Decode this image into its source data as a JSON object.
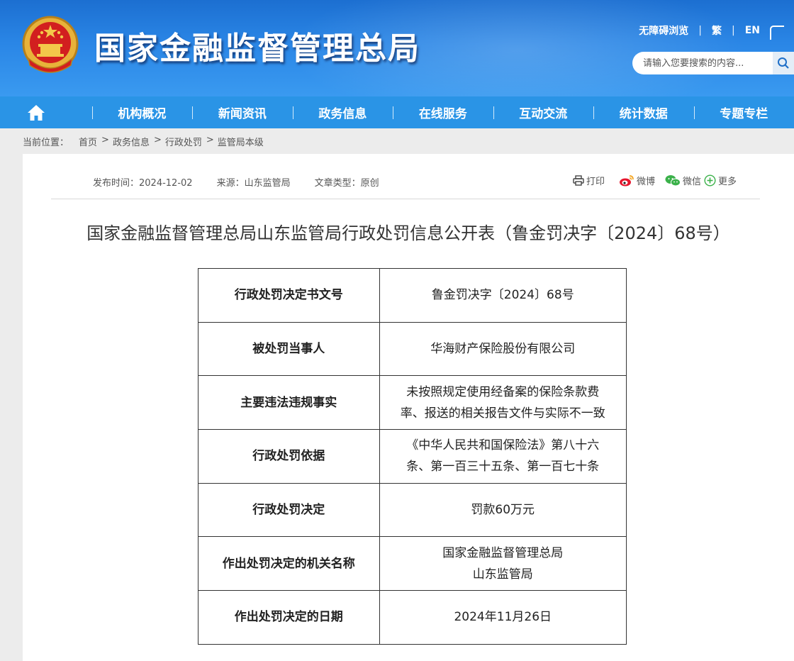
{
  "header": {
    "site_title": "国家金融监督管理总局",
    "top_links": [
      "无障碍浏览",
      "繁",
      "EN"
    ],
    "search_placeholder": "请输入您要搜索的内容..."
  },
  "nav": {
    "items": [
      "机构概况",
      "新闻资讯",
      "政务信息",
      "在线服务",
      "互动交流",
      "统计数据",
      "专题专栏"
    ]
  },
  "breadcrumb": {
    "label": "当前位置：",
    "items": [
      "首页",
      "政务信息",
      "行政处罚",
      "监管局本级"
    ]
  },
  "article": {
    "publish_time": "发布时间：2024-12-02",
    "source": "来源：山东监管局",
    "type": "文章类型：原创",
    "share": {
      "print": "打印",
      "weibo": "微博",
      "wechat": "微信",
      "more": "更多"
    },
    "title": "国家金融监督管理总局山东监管局行政处罚信息公开表（鲁金罚决字〔2024〕68号）"
  },
  "table": {
    "rows": [
      {
        "key": "行政处罚决定书文号",
        "value": [
          "鲁金罚决字〔2024〕68号"
        ]
      },
      {
        "key": "被处罚当事人",
        "value": [
          "华海财产保险股份有限公司"
        ]
      },
      {
        "key": "主要违法违规事实",
        "value": [
          "未按照规定使用经备案的保险条款费",
          "率、报送的相关报告文件与实际不一致"
        ]
      },
      {
        "key": "行政处罚依据",
        "value": [
          "《中华人民共和国保险法》第八十六",
          "条、第一百三十五条、第一百七十条"
        ]
      },
      {
        "key": "行政处罚决定",
        "value": [
          "罚款60万元"
        ]
      },
      {
        "key": "作出处罚决定的机关名称",
        "value": [
          "国家金融监督管理总局",
          "山东监管局"
        ]
      },
      {
        "key": "作出处罚决定的日期",
        "value": [
          "2024年11月26日"
        ]
      }
    ]
  },
  "colors": {
    "header_top": "#1c6fd1",
    "nav_bg": "#2a94e6",
    "page_bg": "#ececec"
  },
  "icons": [
    "national-emblem",
    "home-icon",
    "search-icon",
    "print-icon",
    "weibo-icon",
    "wechat-icon",
    "more-icon"
  ]
}
